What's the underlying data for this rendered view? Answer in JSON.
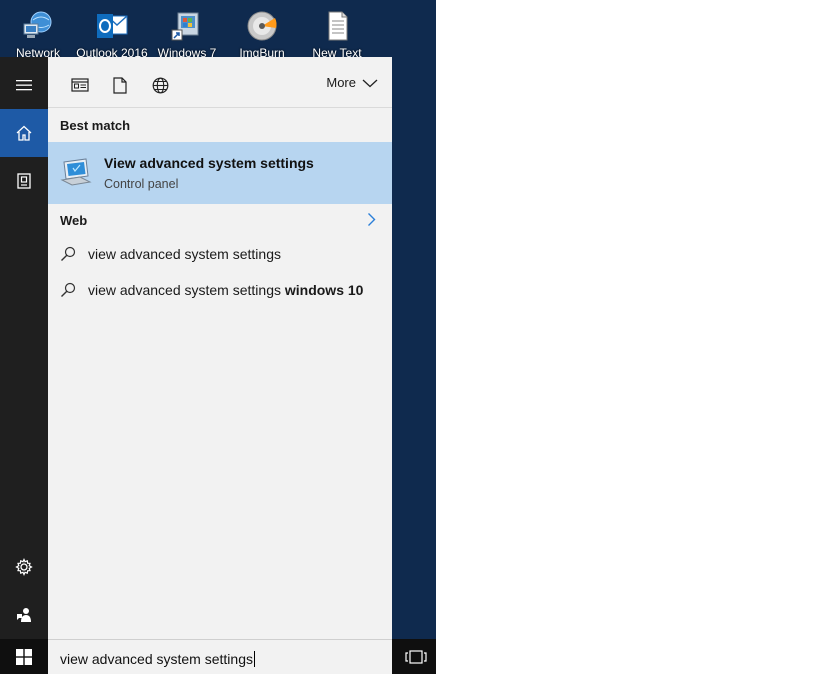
{
  "desktop": {
    "icons": [
      {
        "label": "Network",
        "icon": "network-icon"
      },
      {
        "label": "Outlook 2016",
        "icon": "outlook-icon"
      },
      {
        "label": "Windows 7",
        "icon": "windows7-shortcut-icon"
      },
      {
        "label": "ImgBurn",
        "icon": "imgburn-disc-icon"
      },
      {
        "label": "New Text",
        "icon": "text-document-icon"
      }
    ]
  },
  "rail": {
    "items": [
      {
        "icon": "hamburger-menu-icon"
      },
      {
        "icon": "home-icon",
        "active": true
      },
      {
        "icon": "notebook-icon"
      },
      {
        "icon": "settings-gear-icon"
      },
      {
        "icon": "feedback-icon"
      }
    ]
  },
  "filterbar": {
    "filters": [
      {
        "icon": "apps-filter-icon"
      },
      {
        "icon": "documents-filter-icon"
      },
      {
        "icon": "web-filter-icon"
      }
    ],
    "more_label": "More"
  },
  "results": {
    "best_match_heading": "Best match",
    "best_match": {
      "title": "View advanced system settings",
      "subtitle": "Control panel",
      "icon": "system-computer-icon"
    },
    "web_heading": "Web",
    "web_items": [
      {
        "text": "view advanced system settings",
        "bold_suffix": ""
      },
      {
        "text": "view advanced system settings ",
        "bold_suffix": "windows 10"
      }
    ]
  },
  "taskbar": {
    "search_value": "view advanced system settings"
  },
  "colors": {
    "desktop_bg": "#0f2a4e",
    "rail_bg": "#1f1f1f",
    "rail_active": "#1e5aa6",
    "best_match_highlight": "#b7d5f0",
    "panel_bg": "#f2f2f2",
    "accent_chevron": "#2b7fd8"
  }
}
